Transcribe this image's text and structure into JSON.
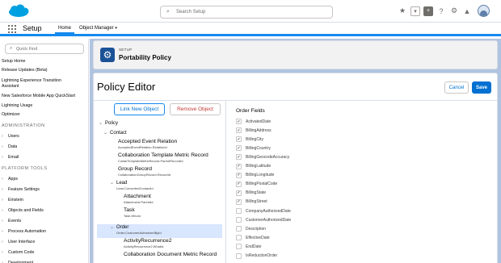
{
  "colors": {
    "brand": "#00a1e0",
    "accent": "#0070d2",
    "header_icon": "#1b5297",
    "danger": "#c23934",
    "selected_row": "#d8e6fe"
  },
  "header": {
    "search_placeholder": "Search Setup",
    "icons": [
      "plus-box-icon",
      "guidance-center-icon",
      "question-icon",
      "gear-icon",
      "bell-icon",
      "avatar"
    ]
  },
  "nav": {
    "app_title": "Setup",
    "tabs": [
      "Home",
      "Object Manager"
    ]
  },
  "sidebar": {
    "quick_find_placeholder": "Quick Find",
    "items": [
      {
        "label": "Setup Home",
        "type": "link"
      },
      {
        "label": "Release Updates (Beta)",
        "type": "link"
      },
      {
        "label": "Lightning Experience Transition",
        "type": "link"
      },
      {
        "label": "Assistant",
        "type": "link-cont"
      },
      {
        "label": "New Salesforce Mobile App QuickStart",
        "type": "link"
      },
      {
        "label": "Lightning Usage",
        "type": "link"
      },
      {
        "label": "Optimizer",
        "type": "link"
      },
      {
        "label": "ADMINISTRATION",
        "type": "header"
      },
      {
        "label": "Users",
        "type": "expand"
      },
      {
        "label": "Data",
        "type": "expand"
      },
      {
        "label": "Email",
        "type": "expand"
      },
      {
        "label": "PLATFORM TOOLS",
        "type": "header"
      },
      {
        "label": "Apps",
        "type": "expand"
      },
      {
        "label": "Feature Settings",
        "type": "expand"
      },
      {
        "label": "Einstein",
        "type": "expand"
      },
      {
        "label": "Objects and Fields",
        "type": "expand"
      },
      {
        "label": "Events",
        "type": "expand"
      },
      {
        "label": "Process Automation",
        "type": "expand"
      },
      {
        "label": "User Interface",
        "type": "expand"
      },
      {
        "label": "Custom Code",
        "type": "expand"
      },
      {
        "label": "Development",
        "type": "expand"
      }
    ]
  },
  "page_header": {
    "eyebrow": "SETUP",
    "title": "Portability Policy"
  },
  "editor": {
    "title": "Policy Editor",
    "cancel_label": "Cancel",
    "save_label": "Save",
    "link_new_label": "Link New Object",
    "remove_label": "Remove Object"
  },
  "tree": {
    "policy": "Policy",
    "contact": "Contact",
    "nodes": [
      {
        "name": "Accepted Event Relation",
        "sub": "AcceptedEventRelation.RelationId"
      },
      {
        "name": "Collaboration Template Metric Record",
        "sub": "CollabTemplateMetricRecord.ParentRecordId"
      },
      {
        "name": "Group Record",
        "sub": "CollaborationGroupRecord.RecordId"
      }
    ],
    "lead": {
      "name": "Lead",
      "sub": "Lead.ConvertedContactId"
    },
    "lead_children": [
      {
        "name": "Attachment",
        "sub": "Attachment.ParentId"
      },
      {
        "name": "Task",
        "sub": "Task.WhoId"
      }
    ],
    "order": {
      "name": "Order",
      "sub": "Order.CustomerAuthorizedById"
    },
    "order_children": [
      {
        "name": "ActivityRecurrence2",
        "sub": "ActivityRecurrence2.WhatId"
      },
      {
        "name": "Collaboration Document Metric Record",
        "sub": ""
      }
    ]
  },
  "order_fields": {
    "title": "Order Fields",
    "fields": [
      {
        "label": "ActivatedDate",
        "checked": true
      },
      {
        "label": "BillingAddress",
        "checked": true
      },
      {
        "label": "BillingCity",
        "checked": true
      },
      {
        "label": "BillingCountry",
        "checked": true
      },
      {
        "label": "BillingGeocodeAccuracy",
        "checked": true
      },
      {
        "label": "BillingLatitude",
        "checked": true
      },
      {
        "label": "BillingLongitude",
        "checked": true
      },
      {
        "label": "BillingPostalCode",
        "checked": true
      },
      {
        "label": "BillingState",
        "checked": true
      },
      {
        "label": "BillingStreet",
        "checked": true
      },
      {
        "label": "CompanyAuthorizedDate",
        "checked": false
      },
      {
        "label": "CustomerAuthorizedDate",
        "checked": false
      },
      {
        "label": "Description",
        "checked": false
      },
      {
        "label": "EffectiveDate",
        "checked": false
      },
      {
        "label": "EndDate",
        "checked": false
      },
      {
        "label": "IsReductionOrder",
        "checked": false
      }
    ]
  }
}
